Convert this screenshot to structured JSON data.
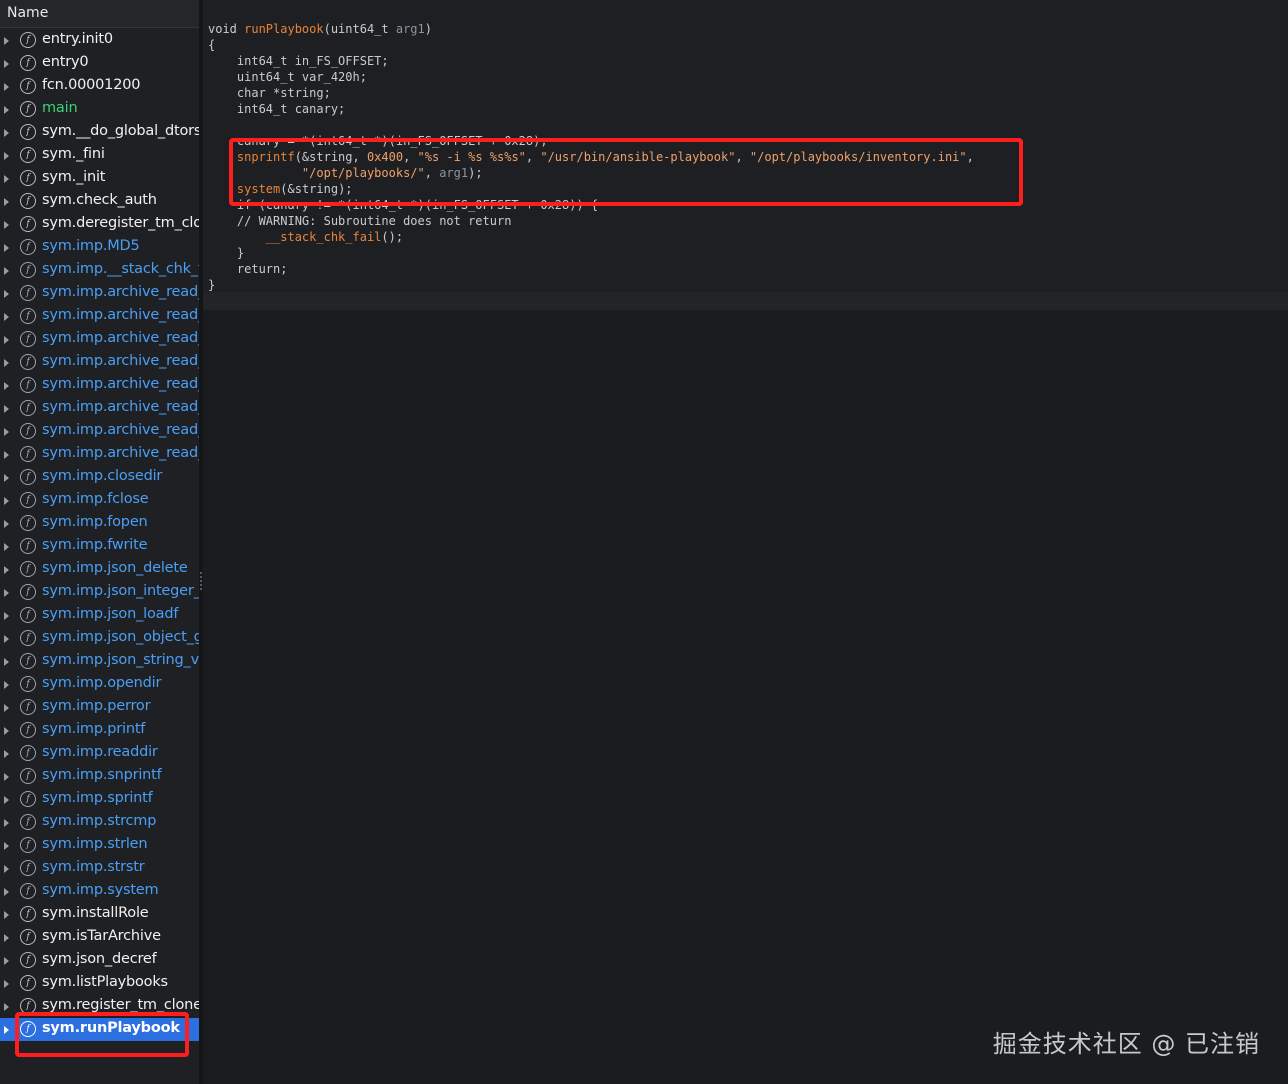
{
  "sidebar": {
    "header": "Name",
    "items": [
      {
        "label": "entry.init0",
        "kind": "normal"
      },
      {
        "label": "entry0",
        "kind": "normal"
      },
      {
        "label": "fcn.00001200",
        "kind": "normal"
      },
      {
        "label": "main",
        "kind": "main"
      },
      {
        "label": "sym.__do_global_dtors",
        "kind": "normal"
      },
      {
        "label": "sym._fini",
        "kind": "normal"
      },
      {
        "label": "sym._init",
        "kind": "normal"
      },
      {
        "label": "sym.check_auth",
        "kind": "normal"
      },
      {
        "label": "sym.deregister_tm_clon",
        "kind": "normal"
      },
      {
        "label": "sym.imp.MD5",
        "kind": "import"
      },
      {
        "label": "sym.imp.__stack_chk_fa",
        "kind": "import"
      },
      {
        "label": "sym.imp.archive_read_",
        "kind": "import"
      },
      {
        "label": "sym.imp.archive_read_",
        "kind": "import"
      },
      {
        "label": "sym.imp.archive_read_",
        "kind": "import"
      },
      {
        "label": "sym.imp.archive_read_",
        "kind": "import"
      },
      {
        "label": "sym.imp.archive_read_",
        "kind": "import"
      },
      {
        "label": "sym.imp.archive_read_",
        "kind": "import"
      },
      {
        "label": "sym.imp.archive_read_",
        "kind": "import"
      },
      {
        "label": "sym.imp.archive_read_",
        "kind": "import"
      },
      {
        "label": "sym.imp.closedir",
        "kind": "import"
      },
      {
        "label": "sym.imp.fclose",
        "kind": "import"
      },
      {
        "label": "sym.imp.fopen",
        "kind": "import"
      },
      {
        "label": "sym.imp.fwrite",
        "kind": "import"
      },
      {
        "label": "sym.imp.json_delete",
        "kind": "import"
      },
      {
        "label": "sym.imp.json_integer_v",
        "kind": "import"
      },
      {
        "label": "sym.imp.json_loadf",
        "kind": "import"
      },
      {
        "label": "sym.imp.json_object_g",
        "kind": "import"
      },
      {
        "label": "sym.imp.json_string_va",
        "kind": "import"
      },
      {
        "label": "sym.imp.opendir",
        "kind": "import"
      },
      {
        "label": "sym.imp.perror",
        "kind": "import"
      },
      {
        "label": "sym.imp.printf",
        "kind": "import"
      },
      {
        "label": "sym.imp.readdir",
        "kind": "import"
      },
      {
        "label": "sym.imp.snprintf",
        "kind": "import"
      },
      {
        "label": "sym.imp.sprintf",
        "kind": "import"
      },
      {
        "label": "sym.imp.strcmp",
        "kind": "import"
      },
      {
        "label": "sym.imp.strlen",
        "kind": "import"
      },
      {
        "label": "sym.imp.strstr",
        "kind": "import"
      },
      {
        "label": "sym.imp.system",
        "kind": "import"
      },
      {
        "label": "sym.installRole",
        "kind": "normal"
      },
      {
        "label": "sym.isTarArchive",
        "kind": "normal"
      },
      {
        "label": "sym.json_decref",
        "kind": "normal"
      },
      {
        "label": "sym.listPlaybooks",
        "kind": "normal"
      },
      {
        "label": "sym.register_tm_clones",
        "kind": "normal"
      },
      {
        "label": "sym.runPlaybook",
        "kind": "selected"
      }
    ]
  },
  "code": {
    "lines": [
      [
        [
          "ty",
          "void "
        ],
        [
          "fn",
          "runPlaybook"
        ],
        [
          "ty",
          "(uint64_t "
        ],
        [
          "ar",
          "arg1"
        ],
        [
          "ty",
          ")"
        ]
      ],
      [
        [
          "ty",
          "{"
        ]
      ],
      [
        [
          "ty",
          "    int64_t in_FS_OFFSET;"
        ]
      ],
      [
        [
          "ty",
          "    uint64_t var_420h;"
        ]
      ],
      [
        [
          "ty",
          "    char *string;"
        ]
      ],
      [
        [
          "ty",
          "    int64_t canary;"
        ]
      ],
      [
        [
          "ty",
          " "
        ]
      ],
      [
        [
          "ty",
          "    canary = *(int64_t *)(in_FS_OFFSET + 0x28);"
        ]
      ],
      [
        [
          "ty",
          "    "
        ],
        [
          "fn",
          "snprintf"
        ],
        [
          "ty",
          "(&string, "
        ],
        [
          "num",
          "0x400"
        ],
        [
          "ty",
          ", "
        ],
        [
          "str",
          "\"%s -i %s %s%s\""
        ],
        [
          "ty",
          ", "
        ],
        [
          "str",
          "\"/usr/bin/ansible-playbook\""
        ],
        [
          "ty",
          ", "
        ],
        [
          "str",
          "\"/opt/playbooks/inventory.ini\""
        ],
        [
          "ty",
          ","
        ]
      ],
      [
        [
          "ty",
          "             "
        ],
        [
          "str",
          "\"/opt/playbooks/\""
        ],
        [
          "ty",
          ", "
        ],
        [
          "ar",
          "arg1"
        ],
        [
          "ty",
          ");"
        ]
      ],
      [
        [
          "ty",
          "    "
        ],
        [
          "fn",
          "system"
        ],
        [
          "ty",
          "(&string);"
        ]
      ],
      [
        [
          "ty",
          "    if (canary != *(int64_t *)(in_FS_OFFSET + 0x28)) {"
        ]
      ],
      [
        [
          "cm",
          "    // WARNING: Subroutine does not return"
        ]
      ],
      [
        [
          "ty",
          "        "
        ],
        [
          "fn",
          "__stack_chk_fail"
        ],
        [
          "ty",
          "();"
        ]
      ],
      [
        [
          "ty",
          "    }"
        ]
      ],
      [
        [
          "ty",
          "    return;"
        ]
      ],
      [
        [
          "ty",
          "}"
        ]
      ]
    ]
  },
  "watermark": "掘金技术社区 @ 已注销",
  "colors": {
    "highlight": "#ff1e1e",
    "selected_row": "#2c6fe0",
    "import_name": "#4a9ff5",
    "main_name": "#3ed07a",
    "function_name": "#e8843a"
  }
}
